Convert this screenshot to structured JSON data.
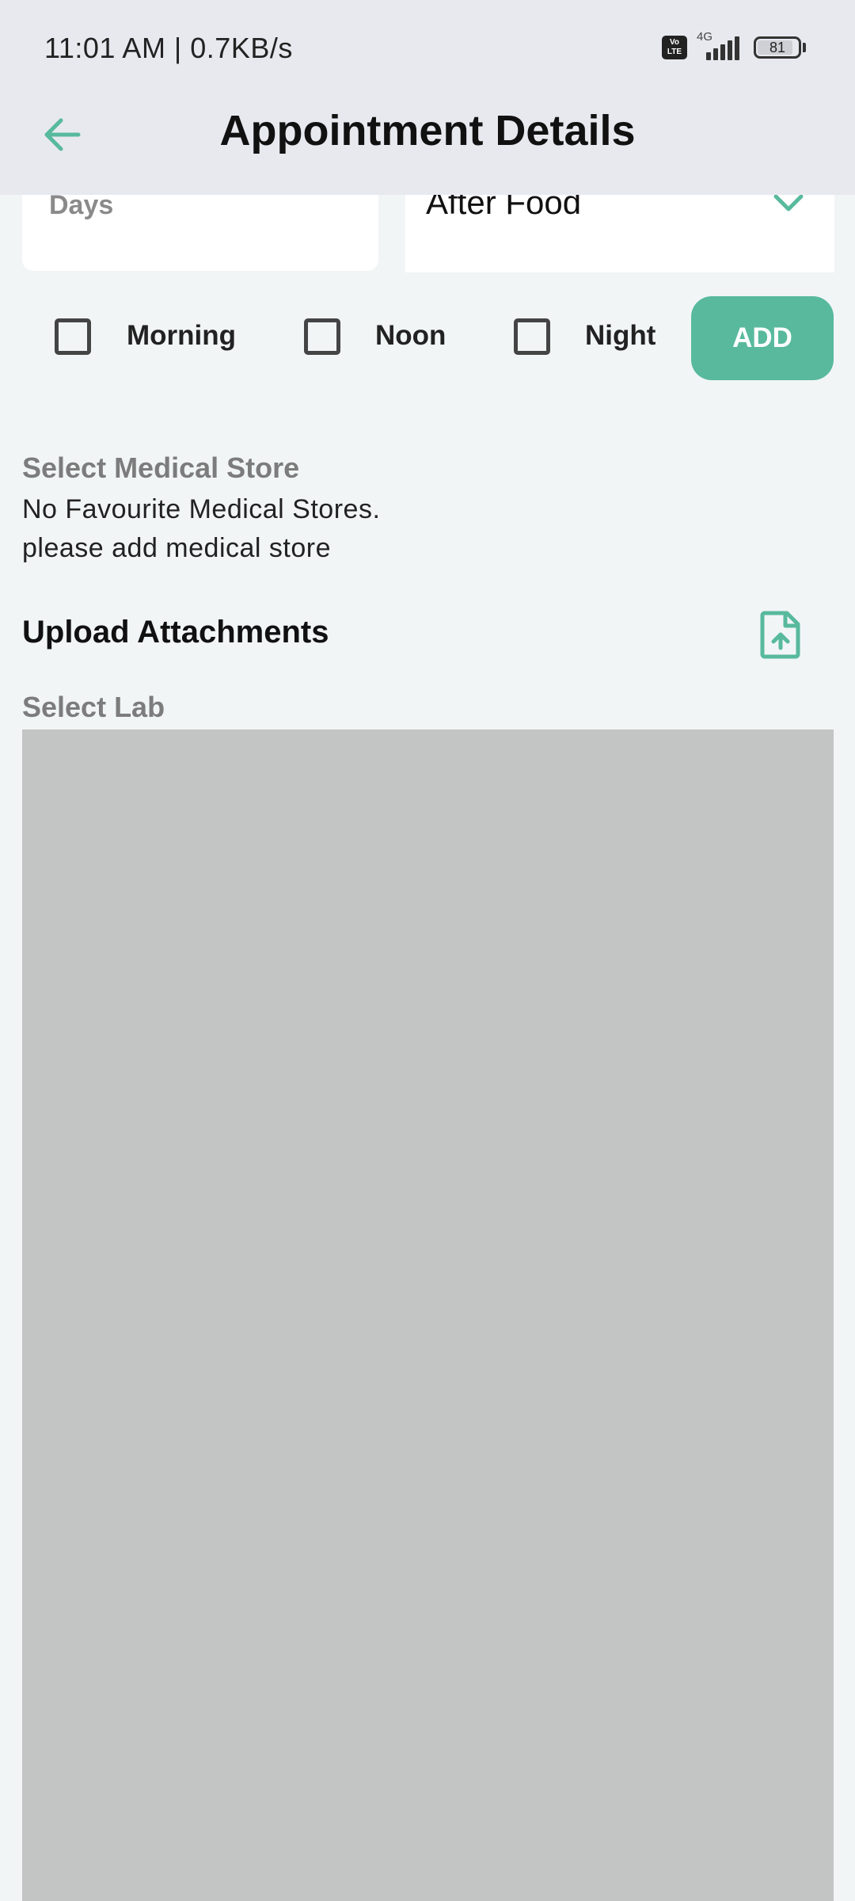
{
  "status_bar": {
    "time": "11:01 AM | 0.7KB/s",
    "volte": "Vo\nLTE",
    "network": "4G",
    "battery": "81"
  },
  "header": {
    "title": "Appointment Details",
    "back_icon": "arrow-left-icon"
  },
  "form": {
    "days_placeholder": "Days",
    "food_timing": "After Food",
    "timing_options": [
      "Morning",
      "Noon",
      "Night"
    ],
    "add_label": "ADD"
  },
  "medical_store": {
    "label": "Select Medical Store",
    "empty_line1": "No Favourite Medical Stores.",
    "empty_line2": "please add medical store"
  },
  "attachments": {
    "title": "Upload Attachments",
    "icon": "file-upload-icon"
  },
  "lab": {
    "label": "Select Lab"
  },
  "colors": {
    "accent": "#58b99d",
    "background": "#f1f5f6",
    "header_bg": "#e8e9ef",
    "lab_panel": "#c3c4c4"
  }
}
